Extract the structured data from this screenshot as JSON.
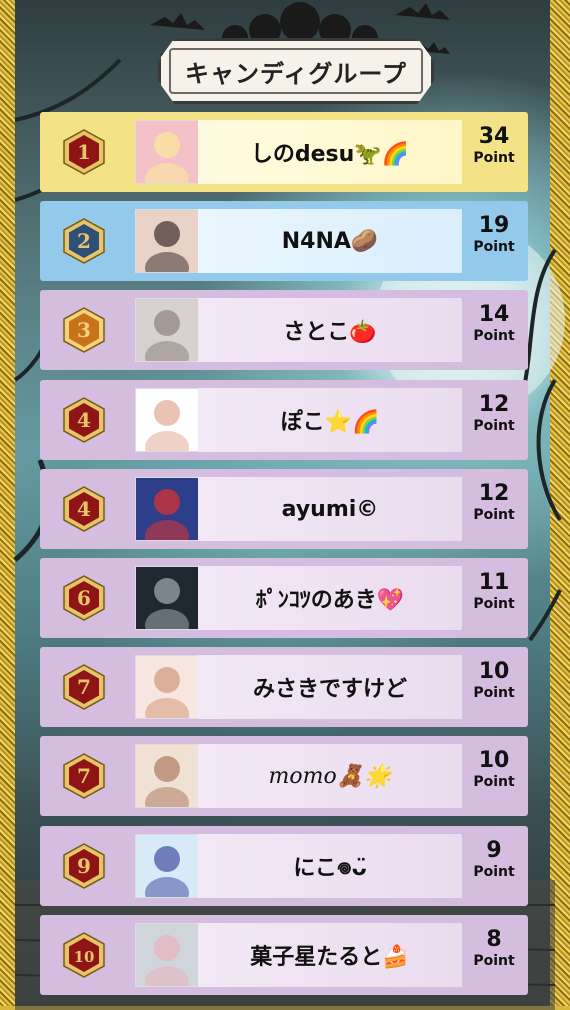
{
  "title": "キャンディグループ",
  "point_unit": "Point",
  "colors": {
    "gold": "#f7ea98",
    "blue": "#9ccfef",
    "purple": "#dcc3e6",
    "badge_red": "#8f1416",
    "badge_blue": "#2e4f7a",
    "badge_orange": "#c8731a"
  },
  "rows": [
    {
      "rank": "1",
      "name": "しのdesu🦖🌈",
      "points": "34",
      "theme": "gold"
    },
    {
      "rank": "2",
      "name": "N4NA🥔",
      "points": "19",
      "theme": "blue"
    },
    {
      "rank": "3",
      "name": "さとこ🍅",
      "points": "14",
      "theme": "purple"
    },
    {
      "rank": "4",
      "name": "ぽこ⭐🌈",
      "points": "12",
      "theme": "purple"
    },
    {
      "rank": "4",
      "name": "ayumi©",
      "points": "12",
      "theme": "purple"
    },
    {
      "rank": "6",
      "name": "ﾎﾟﾝｺﾂのあき💖",
      "points": "11",
      "theme": "purple"
    },
    {
      "rank": "7",
      "name": "みさきですけど",
      "points": "10",
      "theme": "purple"
    },
    {
      "rank": "7",
      "name": "momo🧸🌟",
      "points": "10",
      "theme": "purple"
    },
    {
      "rank": "9",
      "name": "にこ𖦹ᴗ̈",
      "points": "9",
      "theme": "purple"
    },
    {
      "rank": "10",
      "name": "菓子星たると🍰",
      "points": "8",
      "theme": "purple"
    }
  ]
}
